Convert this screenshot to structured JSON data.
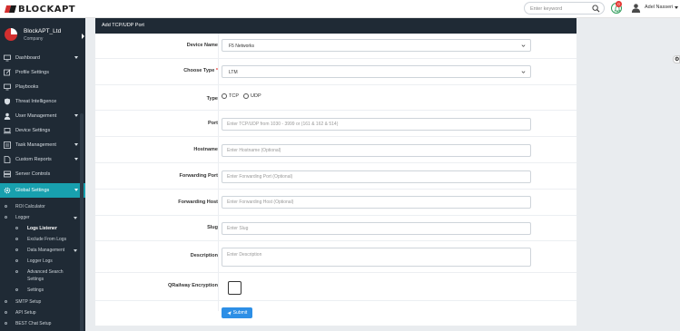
{
  "header": {
    "brand": "BLOCKAPT",
    "search_placeholder": "Enter keyword",
    "notification_count": "0",
    "username": "Adel Nasseri"
  },
  "sidebar": {
    "company_name": "BlockAPT_Ltd",
    "company_sub": "Company",
    "items": [
      {
        "label": "Dashboard",
        "icon": "monitor-icon",
        "expandable": true
      },
      {
        "label": "Profile Settings",
        "icon": "edit-icon",
        "expandable": false
      },
      {
        "label": "Playbooks",
        "icon": "monitor-icon",
        "expandable": false
      },
      {
        "label": "Threat Intelligence",
        "icon": "shield-icon",
        "expandable": false
      },
      {
        "label": "User Management",
        "icon": "user-icon",
        "expandable": true
      },
      {
        "label": "Device Settings",
        "icon": "laptop-icon",
        "expandable": false
      },
      {
        "label": "Task Management",
        "icon": "task-icon",
        "expandable": true
      },
      {
        "label": "Custom Reports",
        "icon": "report-icon",
        "expandable": true
      },
      {
        "label": "Server Controls",
        "icon": "server-icon",
        "expandable": false
      },
      {
        "label": "Global Settings",
        "icon": "gear-icon",
        "expandable": true,
        "active": true
      }
    ],
    "sub_items": [
      {
        "label": "ROI Calculator",
        "level": 1
      },
      {
        "label": "Logger",
        "level": 1,
        "expandable": true
      },
      {
        "label": "Logs Listener",
        "level": 2,
        "current": true
      },
      {
        "label": "Exclude From Logs",
        "level": 2
      },
      {
        "label": "Data Management",
        "level": 2,
        "expandable": true
      },
      {
        "label": "Logger Logs",
        "level": 2
      },
      {
        "label": "Advanced Search",
        "level": 2
      },
      {
        "label": "Settings",
        "level": 2
      },
      {
        "label": "Settings",
        "level": 2
      },
      {
        "label": "SMTP Setup",
        "level": 1
      },
      {
        "label": "API Setup",
        "level": 1
      },
      {
        "label": "BEST Chat Setup",
        "level": 1
      }
    ]
  },
  "form": {
    "title": "Add TCP/UDP Port",
    "device_name_label": "Device Name",
    "device_name_value": "F5 Networks",
    "choose_type_label": "Choose Type",
    "required_mark": "*",
    "choose_type_value": "LTM",
    "type_label": "Type",
    "type_options": [
      "TCP",
      "UDP"
    ],
    "port_label": "Port",
    "port_placeholder": "Enter TCP/UDP from 1030 - 3999 or (161 & 162 & 514)",
    "hostname_label": "Hostname",
    "hostname_placeholder": "Enter Hostname (Optional)",
    "forwarding_port_label": "Forwarding Port",
    "forwarding_port_placeholder": "Enter Forwarding Port (Optional)",
    "forwarding_host_label": "Forwarding Host",
    "forwarding_host_placeholder": "Enter Forwarding Host (Optional)",
    "slug_label": "Slug",
    "slug_placeholder": "Enter Slug",
    "description_label": "Description",
    "description_placeholder": "Enter Description",
    "qrailway_label": "QRailway Encryption",
    "submit_label": "Submit"
  },
  "colors": {
    "sidebar_bg": "#1f2a35",
    "active_item": "#18a0ae",
    "submit_button": "#2d8fe6",
    "brand_red": "#d32f2f"
  }
}
